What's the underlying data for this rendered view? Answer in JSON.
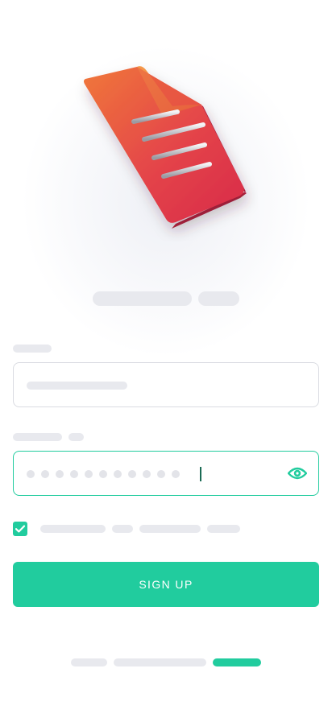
{
  "signup": {
    "button_label": "SIGN UP"
  },
  "colors": {
    "accent": "#21cc9e",
    "skeleton": "#e8e9ee",
    "document_red": "#e0394a",
    "document_orange": "#f07a3a"
  },
  "icons": {
    "illustration": "document-icon",
    "password_toggle": "eye-icon",
    "checkbox": "check-icon"
  },
  "terms": {
    "checked": true
  },
  "onboarding": {
    "page_count": 3,
    "current_page": 3
  }
}
